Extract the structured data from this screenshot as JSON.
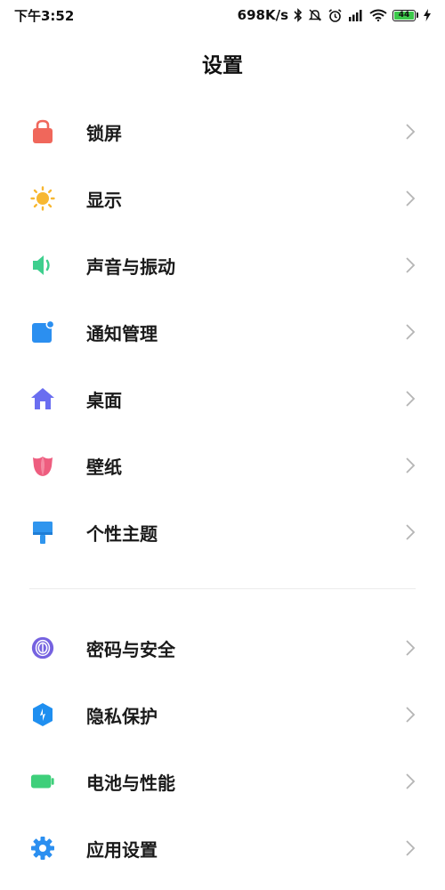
{
  "status_bar": {
    "time": "下午3:52",
    "network_speed": "698K/s",
    "battery_level": "44",
    "icons": [
      "bluetooth-icon",
      "mute-icon",
      "alarm-icon",
      "signal-icon",
      "wifi-icon",
      "battery-icon",
      "charging-icon"
    ]
  },
  "header": {
    "title": "设置"
  },
  "settings": {
    "group1": [
      {
        "label": "锁屏",
        "icon": "lock-icon",
        "color": "#f0675b"
      },
      {
        "label": "显示",
        "icon": "sun-icon",
        "color": "#f7b731"
      },
      {
        "label": "声音与振动",
        "icon": "speaker-icon",
        "color": "#3ecf8e"
      },
      {
        "label": "通知管理",
        "icon": "notification-icon",
        "color": "#2b8ff0"
      },
      {
        "label": "桌面",
        "icon": "home-icon",
        "color": "#6a6ef0"
      },
      {
        "label": "壁纸",
        "icon": "tulip-icon",
        "color": "#ee5d7f"
      },
      {
        "label": "个性主题",
        "icon": "brush-icon",
        "color": "#2f95ee"
      }
    ],
    "group2": [
      {
        "label": "密码与安全",
        "icon": "fingerprint-icon",
        "color": "#7562e0"
      },
      {
        "label": "隐私保护",
        "icon": "shield-icon",
        "color": "#1f8ff0"
      },
      {
        "label": "电池与性能",
        "icon": "battery-perf-icon",
        "color": "#3ecf7a"
      },
      {
        "label": "应用设置",
        "icon": "gear-icon",
        "color": "#2b8ff0"
      }
    ]
  }
}
